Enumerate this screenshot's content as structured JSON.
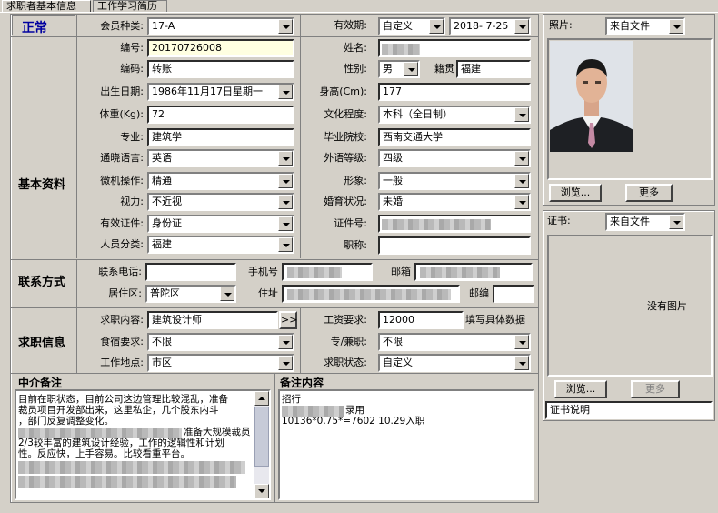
{
  "tabs": [
    {
      "label": "求职者基本信息"
    },
    {
      "label": "工作学习简历"
    }
  ],
  "status": "正常",
  "sections": {
    "basic": "基本资料",
    "contact": "联系方式",
    "job": "求职信息",
    "agency_note": "中介备注",
    "note_content": "备注内容"
  },
  "labels": {
    "member_type": "会员种类:",
    "validity": "有效期:",
    "number": "编号:",
    "name": "姓名:",
    "code": "编码:",
    "gender": "性别:",
    "origin": "籍贯",
    "birth": "出生日期:",
    "height": "身高(Cm):",
    "weight": "体重(Kg):",
    "education": "文化程度:",
    "major": "专业:",
    "school": "毕业院校:",
    "language": "通晓语言:",
    "foreign_level": "外语等级:",
    "computer": "微机操作:",
    "image": "形象:",
    "vision": "视力:",
    "marriage": "婚育状况:",
    "id_type": "有效证件:",
    "id_no": "证件号:",
    "category": "人员分类:",
    "title": "职称:",
    "phone": "联系电话:",
    "mobile": "手机号",
    "email": "邮箱",
    "district": "居住区:",
    "address": "住址",
    "postcode": "邮编",
    "job_content": "求职内容:",
    "salary": "工资要求:",
    "salary_hint": "填写具体数据",
    "board": "食宿要求:",
    "fulltime": "专/兼职:",
    "location": "工作地点:",
    "job_status": "求职状态:",
    "photo": "照片:",
    "cert": "证书:"
  },
  "values": {
    "member_type": "17-A",
    "validity": "自定义",
    "validity_date": "2018- 7-25",
    "number": "20170726008",
    "code": "转账",
    "gender": "男",
    "origin": "福建",
    "birth": "1986年11月17日星期一",
    "height": "177",
    "weight": "72",
    "education": "本科（全日制）",
    "major": "建筑学",
    "school": "西南交通大学",
    "language": "英语",
    "foreign_level": "四级",
    "computer": "精通",
    "image": "一般",
    "vision": "不近视",
    "marriage": "未婚",
    "id_type": "身份证",
    "category": "福建",
    "district": "普陀区",
    "job_content": "建筑设计师",
    "salary": "12000",
    "board": "不限",
    "fulltime": "不限",
    "location": "市区",
    "job_status": "自定义",
    "photo_source": "来自文件",
    "cert_source": "来自文件",
    "cert_desc": "证书说明"
  },
  "buttons": {
    "more_arrow": ">>",
    "browse": "浏览...",
    "more": "更多",
    "no_image": "没有图片"
  },
  "agency_note_lines": [
    "目前在职状态，目前公司这边管理比较混乱，准备",
    "裁员项目开发部出来，这里私企，几个股东内斗",
    "，部门反复调整变化。",
    "准备大规模裁员",
    "2/3较丰富的建筑设计经验，工作的逻辑性和计划",
    "性。反应快，上手容易。比较看重平台。"
  ],
  "note_content_lines": [
    "招行",
    "录用",
    "10136*0.75*=7602   10.29入职"
  ]
}
